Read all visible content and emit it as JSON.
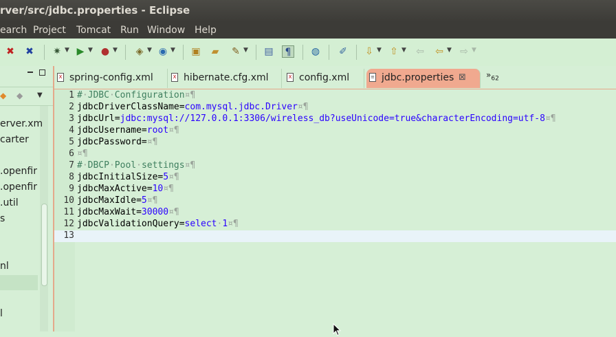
{
  "window": {
    "title": "rver/src/jdbc.properties - Eclipse"
  },
  "menu": [
    "earch",
    "Project",
    "Tomcat",
    "Run",
    "Window",
    "Help"
  ],
  "toolbar": {
    "icons": [
      "debug-config-icon",
      "external-tools-icon",
      "settings-icon",
      "run-icon",
      "run-last-icon",
      "new-server-icon",
      "new-class-icon",
      "open-type-icon",
      "open-folder-icon",
      "search-tool-icon",
      "toggle-mark-icon",
      "show-whitespace-icon",
      "globe-icon",
      "open-perspective-icon",
      "next-annotation-icon",
      "prev-annotation-icon",
      "back-icon",
      "back-nav-icon",
      "forward-icon"
    ]
  },
  "left_panel": {
    "items": [
      "erver.xm",
      "carter",
      ".openfir",
      ".openfir",
      ".util",
      "s",
      "nl",
      "l"
    ]
  },
  "tabs": [
    {
      "label": "spring-config.xml",
      "active": false
    },
    {
      "label": "hibernate.cfg.xml",
      "active": false
    },
    {
      "label": "config.xml",
      "active": false
    },
    {
      "label": "jdbc.properties",
      "active": true
    }
  ],
  "tabs_overflow": {
    "symbol": "»",
    "count": "62"
  },
  "editor": {
    "lines": [
      {
        "num": "1",
        "parts": [
          [
            "cm",
            "#"
          ],
          [
            "ws",
            "·"
          ],
          [
            "cm",
            "JDBC"
          ],
          [
            "ws",
            "·"
          ],
          [
            "cm",
            "Configuration"
          ],
          [
            "ws",
            "¤¶"
          ]
        ]
      },
      {
        "num": "2",
        "parts": [
          [
            "ky",
            "jdbcDriverClassName="
          ],
          [
            "vl",
            "com.mysql.jdbc.Driver"
          ],
          [
            "ws",
            "¤¶"
          ]
        ]
      },
      {
        "num": "3",
        "parts": [
          [
            "ky",
            "jdbcUrl="
          ],
          [
            "vl",
            "jdbc:mysql://127.0.0.1:3306/wireless_db?useUnicode=true&characterEncoding=utf-8"
          ],
          [
            "ws",
            "¤¶"
          ]
        ]
      },
      {
        "num": "4",
        "parts": [
          [
            "ky",
            "jdbcUsername="
          ],
          [
            "vl",
            "root"
          ],
          [
            "ws",
            "¤¶"
          ]
        ]
      },
      {
        "num": "5",
        "parts": [
          [
            "ky",
            "jdbcPassword="
          ],
          [
            "ws",
            "¤¶"
          ]
        ]
      },
      {
        "num": "6",
        "parts": [
          [
            "ws",
            "¤¶"
          ]
        ]
      },
      {
        "num": "7",
        "parts": [
          [
            "cm",
            "#"
          ],
          [
            "ws",
            "·"
          ],
          [
            "cm",
            "DBCP"
          ],
          [
            "ws",
            "·"
          ],
          [
            "cm",
            "Pool"
          ],
          [
            "ws",
            "·"
          ],
          [
            "cm",
            "settings"
          ],
          [
            "ws",
            "¤¶"
          ]
        ]
      },
      {
        "num": "8",
        "parts": [
          [
            "ky",
            "jdbcInitialSize="
          ],
          [
            "vl",
            "5"
          ],
          [
            "ws",
            "¤¶"
          ]
        ]
      },
      {
        "num": "9",
        "parts": [
          [
            "ky",
            "jdbcMaxActive="
          ],
          [
            "vl",
            "10"
          ],
          [
            "ws",
            "¤¶"
          ]
        ]
      },
      {
        "num": "10",
        "parts": [
          [
            "ky",
            "jdbcMaxIdle="
          ],
          [
            "vl",
            "5"
          ],
          [
            "ws",
            "¤¶"
          ]
        ]
      },
      {
        "num": "11",
        "parts": [
          [
            "ky",
            "jdbcMaxWait="
          ],
          [
            "vl",
            "30000"
          ],
          [
            "ws",
            "¤¶"
          ]
        ]
      },
      {
        "num": "12",
        "parts": [
          [
            "ky",
            "jdbcValidationQuery="
          ],
          [
            "vl",
            "select"
          ],
          [
            "ws",
            "·"
          ],
          [
            "vl",
            "1"
          ],
          [
            "ws",
            "¤¶"
          ]
        ]
      },
      {
        "num": "13",
        "parts": []
      }
    ],
    "current_line": "13"
  }
}
